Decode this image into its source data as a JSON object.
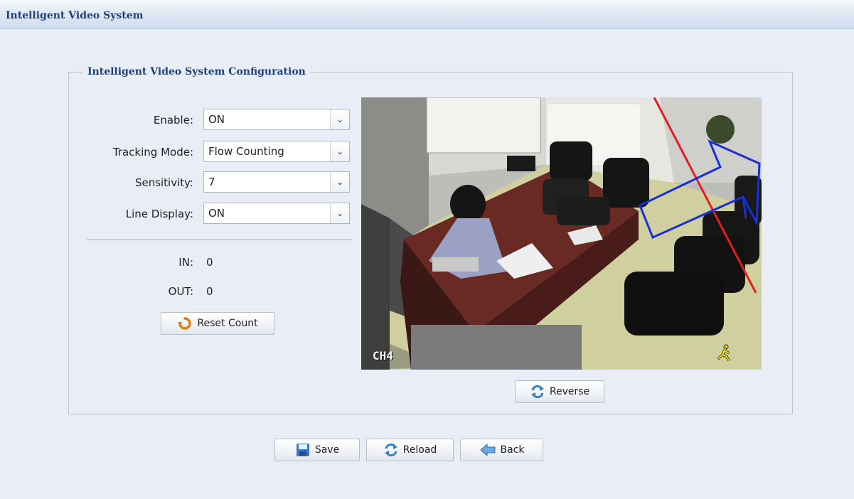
{
  "app": {
    "title": "Intelligent Video System"
  },
  "config": {
    "legend": "Intelligent Video System Configuration",
    "fields": [
      {
        "label": "Enable:",
        "value": "ON"
      },
      {
        "label": "Tracking Mode:",
        "value": "Flow Counting"
      },
      {
        "label": "Sensitivity:",
        "value": "7"
      },
      {
        "label": "Line Display:",
        "value": "ON"
      }
    ],
    "counts": {
      "in_label": "IN:",
      "in_value": "0",
      "out_label": "OUT:",
      "out_value": "0"
    },
    "reset_label": "Reset Count"
  },
  "video": {
    "channel": "CH4",
    "reverse_label": "Reverse"
  },
  "footer": {
    "save_label": "Save",
    "reload_label": "Reload",
    "back_label": "Back"
  },
  "colors": {
    "accent": "#1d3f7a",
    "tripwire": "#e02020",
    "zone": "#1a2fd0"
  },
  "icons": [
    "reset-icon",
    "reverse-icon",
    "save-icon",
    "reload-icon",
    "back-icon",
    "motion-person-icon",
    "chevron-down-icon"
  ]
}
